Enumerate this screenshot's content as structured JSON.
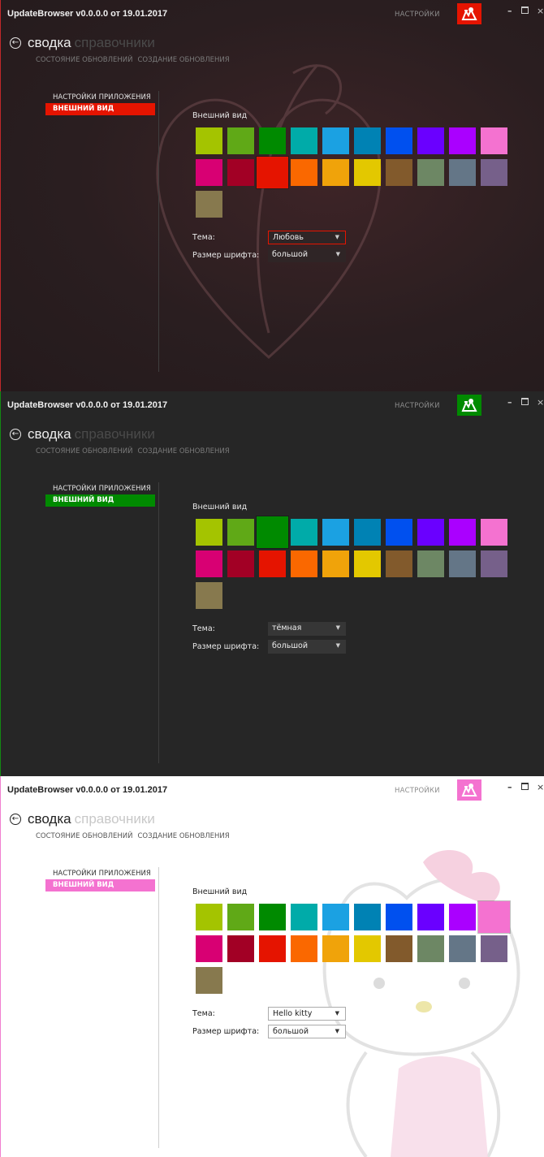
{
  "app": {
    "title": "UpdateBrowser v0.0.0.0 от 19.01.2017",
    "settings_link": "НАСТРОЙКИ",
    "window_controls": {
      "minimize": "–",
      "maximize": "",
      "close": "×"
    }
  },
  "nav": {
    "back_icon": "arrow-left-circle-icon",
    "back_glyph": "←",
    "active": "сводка",
    "inactive": "справочники",
    "sub": [
      "СОСТОЯНИЕ ОБНОВЛЕНИЙ",
      "СОЗДАНИЕ ОБНОВЛЕНИЯ"
    ]
  },
  "sidebar": {
    "header": "НАСТРОЙКИ ПРИЛОЖЕНИЯ",
    "item": "ВНЕШНИЙ ВИД"
  },
  "appearance": {
    "title": "Внешний вид",
    "theme_label": "Тема:",
    "font_label": "Размер шрифта:",
    "dropdown_icon": "caret-down-icon",
    "dropdown_glyph": "▼"
  },
  "palette": [
    "#a4c400",
    "#60a917",
    "#008a00",
    "#00aba9",
    "#1ba1e2",
    "#0082b4",
    "#0050ef",
    "#6a00ff",
    "#aa00ff",
    "#f472d0",
    "#d80073",
    "#a20025",
    "#e51400",
    "#fa6800",
    "#f0a30a",
    "#e3c800",
    "#825a2c",
    "#6d8764",
    "#647687",
    "#76608a",
    "#87794e"
  ],
  "panels": [
    {
      "accent": "#e51400",
      "selected_index": 12,
      "theme_value": "Любовь",
      "font_value": "большой",
      "theme_focused": true
    },
    {
      "accent": "#008a00",
      "selected_index": 2,
      "theme_value": "тёмная",
      "font_value": "большой",
      "theme_focused": false
    },
    {
      "accent": "#f472d0",
      "selected_index": 9,
      "theme_value": "Hello kitty",
      "font_value": "большой",
      "theme_focused": false
    }
  ]
}
